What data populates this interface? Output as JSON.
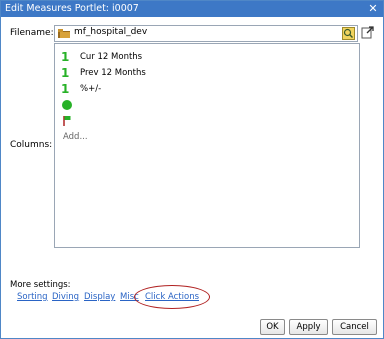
{
  "dialog": {
    "title": "Edit Measures Portlet: i0007",
    "close_glyph": "✕"
  },
  "filename": {
    "label": "Filename:",
    "value": "mf_hospital_dev",
    "icons": [
      "folder-icon",
      "browse-icon",
      "open-external-icon"
    ]
  },
  "columns": {
    "label": "Columns:",
    "items": [
      {
        "glyph": "1",
        "label": "Cur 12 Months",
        "icon": "indicator-one-icon"
      },
      {
        "glyph": "1",
        "label": "Prev 12 Months",
        "icon": "indicator-one-icon"
      },
      {
        "glyph": "1",
        "label": "%+/-",
        "icon": "indicator-one-icon"
      },
      {
        "glyph": "",
        "label": "",
        "icon": "green-dot-icon"
      },
      {
        "glyph": "",
        "label": "",
        "icon": "flag-icon"
      }
    ],
    "add_label": "Add..."
  },
  "more_settings": {
    "label": "More settings:",
    "links": [
      "Sorting",
      "Diving",
      "Display",
      "Misc",
      "Click Actions"
    ]
  },
  "buttons": {
    "ok": "OK",
    "apply": "Apply",
    "cancel": "Cancel"
  },
  "colors": {
    "titlebar": "#3d78c6",
    "link": "#2a64c5",
    "indicator": "#27b127",
    "highlight": "#b02121"
  }
}
